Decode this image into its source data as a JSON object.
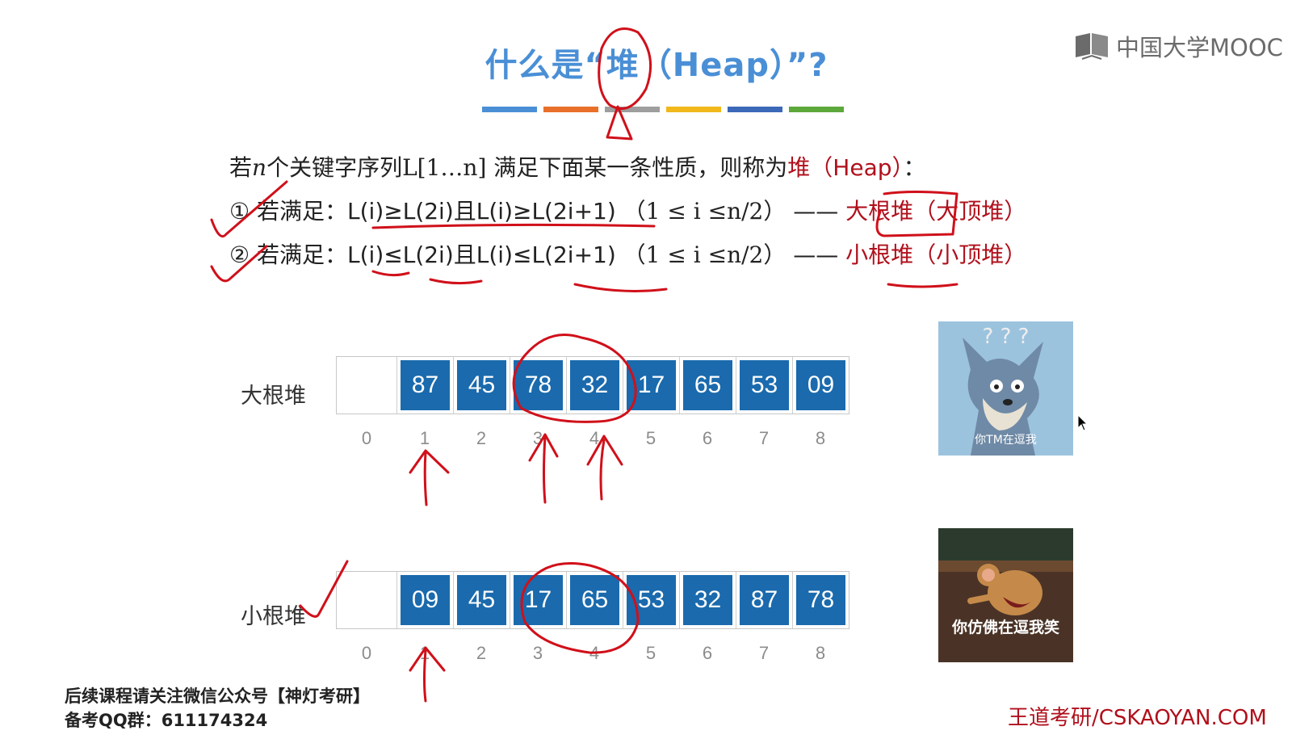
{
  "title": {
    "text": "什么是“堆（Heap）”?",
    "stripe_colors": [
      "#4a8fd6",
      "#e8702a",
      "#9e9e9e",
      "#f2b81c",
      "#3c68b8",
      "#5da83a"
    ]
  },
  "logo": {
    "text": "中国大学MOOC",
    "icon": "book-icon"
  },
  "definition": {
    "line1": {
      "prefix": "若",
      "n": "n",
      "mid": "个关键字序列",
      "seq": "L[1…n]",
      "rest": " 满足下面某一条性质，则称为",
      "term": "堆（Heap）",
      "end": "："
    },
    "line2": {
      "marker": "①",
      "label": "若满足：",
      "formula": "L(i)≥L(2i)且L(i)≥L(2i+1)",
      "range": "（1 ≤ i ≤n/2）",
      "dash": "——",
      "term": "大根堆",
      "alias": "（大顶堆）"
    },
    "line3": {
      "marker": "②",
      "label": "若满足：",
      "formula": "L(i)≤L(2i)且L(i)≤L(2i+1)",
      "range": "（1 ≤ i ≤n/2）",
      "dash": "——",
      "term": "小根堆",
      "alias": "（小顶堆）"
    }
  },
  "max_heap": {
    "label": "大根堆",
    "values": [
      "",
      "87",
      "45",
      "78",
      "32",
      "17",
      "65",
      "53",
      "09"
    ],
    "indices": [
      "0",
      "1",
      "2",
      "3",
      "4",
      "5",
      "6",
      "7",
      "8"
    ]
  },
  "min_heap": {
    "label": "小根堆",
    "values": [
      "",
      "09",
      "45",
      "17",
      "65",
      "53",
      "32",
      "87",
      "78"
    ],
    "indices": [
      "0",
      "1",
      "2",
      "3",
      "4",
      "5",
      "6",
      "7",
      "8"
    ]
  },
  "memes": [
    {
      "caption": "你TM在逗我",
      "marks": "? ? ?"
    },
    {
      "caption": "你仿佛在逗我笑"
    }
  ],
  "footer": {
    "line1": "后续课程请关注微信公众号【神灯考研】",
    "line2": "备考QQ群：611174324",
    "brand": "王道考研/CSKAOYAN.COM"
  },
  "colors": {
    "title_blue": "#4a8fd6",
    "cell_blue": "#1a6aad",
    "term_red": "#b0101c",
    "annotation_red": "#d0101a"
  }
}
